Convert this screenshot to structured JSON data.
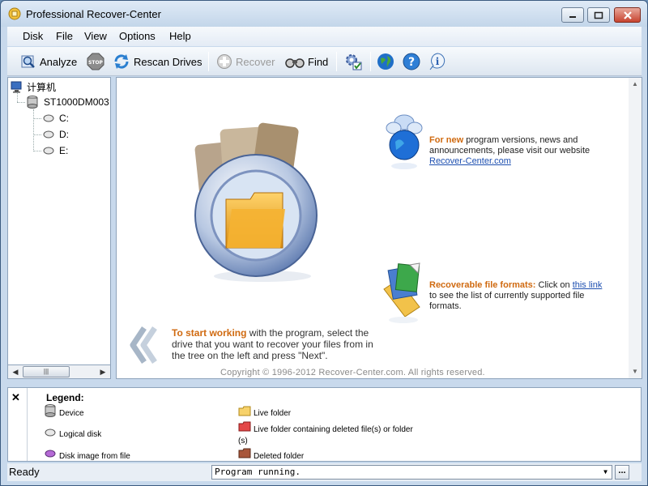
{
  "window": {
    "title": "Professional Recover-Center"
  },
  "menu": [
    "Disk",
    "File",
    "View",
    "Options",
    "Help"
  ],
  "toolbar": {
    "analyze": "Analyze",
    "rescan": "Rescan Drives",
    "recover": "Recover",
    "find": "Find"
  },
  "tree": {
    "root": "计算机",
    "disk": "ST1000DM003",
    "drives": [
      "C:",
      "D:",
      "E:"
    ]
  },
  "main": {
    "news": {
      "heading": "For new",
      "text1": " program versions, news and",
      "text2": "announcements, please visit our website",
      "link": "Recover-Center.com"
    },
    "formats": {
      "heading": "Recoverable file formats:",
      "text1": " Click on ",
      "link": "this link",
      "text2": "to see the list of currently supported file",
      "text3": "formats."
    },
    "start": {
      "heading": "To start working",
      "text": " with the program, select the drive that you want to recover your files from in the tree on the left and press \"Next\"."
    },
    "copyright": "Copyright © 1996-2012 Recover-Center.com. All rights reserved."
  },
  "legend": {
    "close": "✕",
    "title": "Legend:",
    "device": "Device",
    "logical": "Logical disk",
    "image": "Disk image from file",
    "live": "Live folder",
    "live_deleted": "Live folder containing deleted file(s) or folder",
    "live_deleted_suffix": "(s)",
    "deleted": "Deleted folder"
  },
  "status": {
    "text": "Ready",
    "combo": "Program running.",
    "more": "..."
  },
  "colors": {
    "accent_orange": "#d06a10",
    "link_blue": "#1d4fb0"
  }
}
